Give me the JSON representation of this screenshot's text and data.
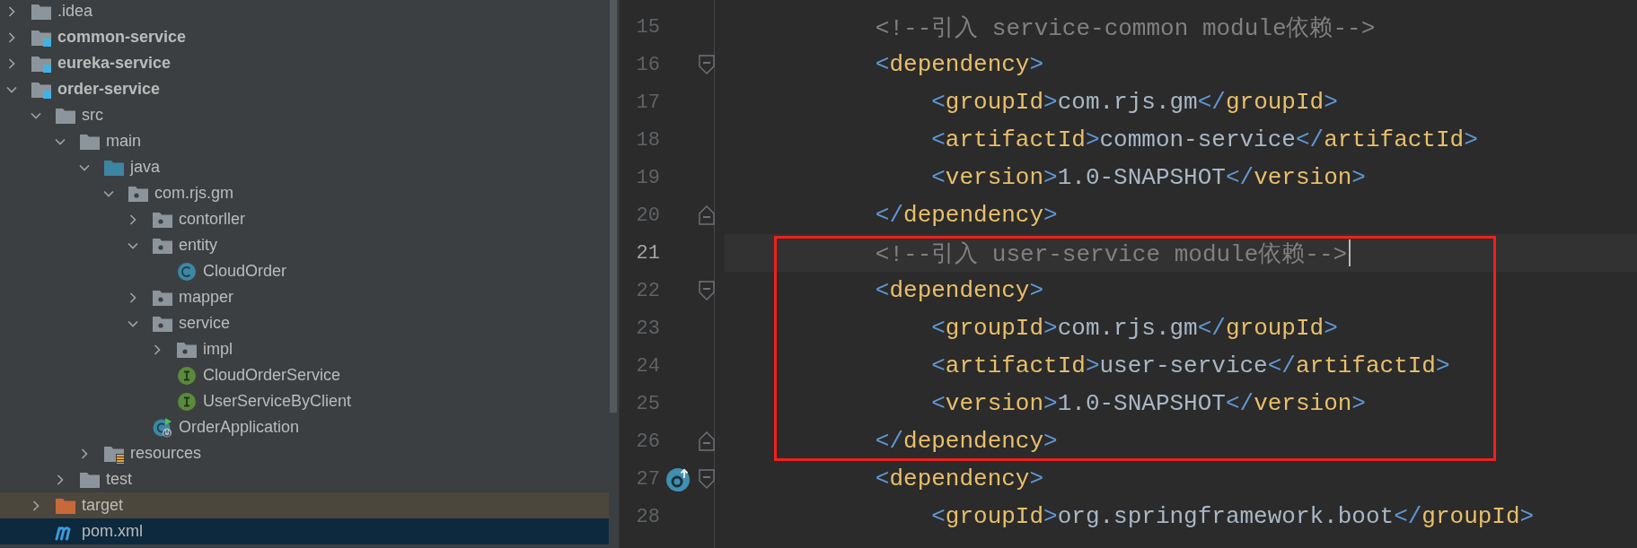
{
  "project_tree": {
    "items": [
      {
        "label": ".idea",
        "kind": "folder",
        "expanded": false,
        "selected": false,
        "highlighted": false
      },
      {
        "label": "common-service",
        "kind": "module",
        "expanded": false,
        "selected": false,
        "highlighted": false
      },
      {
        "label": "eureka-service",
        "kind": "module",
        "expanded": false,
        "selected": false,
        "highlighted": false
      },
      {
        "label": "order-service",
        "kind": "module",
        "expanded": true,
        "selected": false,
        "highlighted": false,
        "children": [
          {
            "label": "src",
            "kind": "folder",
            "expanded": true,
            "selected": false,
            "highlighted": false,
            "children": [
              {
                "label": "main",
                "kind": "folder",
                "expanded": true,
                "selected": false,
                "highlighted": false,
                "children": [
                  {
                    "label": "java",
                    "kind": "source-folder",
                    "expanded": true,
                    "selected": false,
                    "highlighted": false,
                    "children": [
                      {
                        "label": "com.rjs.gm",
                        "kind": "package",
                        "expanded": true,
                        "selected": false,
                        "highlighted": false,
                        "children": [
                          {
                            "label": "contorller",
                            "kind": "package",
                            "expanded": false,
                            "selected": false,
                            "highlighted": false
                          },
                          {
                            "label": "entity",
                            "kind": "package",
                            "expanded": true,
                            "selected": false,
                            "highlighted": false,
                            "children": [
                              {
                                "label": "CloudOrder",
                                "kind": "class",
                                "selected": false,
                                "highlighted": false
                              }
                            ]
                          },
                          {
                            "label": "mapper",
                            "kind": "package",
                            "expanded": false,
                            "selected": false,
                            "highlighted": false
                          },
                          {
                            "label": "service",
                            "kind": "package",
                            "expanded": true,
                            "selected": false,
                            "highlighted": false,
                            "children": [
                              {
                                "label": "impl",
                                "kind": "package",
                                "expanded": false,
                                "selected": false,
                                "highlighted": false
                              },
                              {
                                "label": "CloudOrderService",
                                "kind": "interface",
                                "selected": false,
                                "highlighted": false
                              },
                              {
                                "label": "UserServiceByClient",
                                "kind": "interface",
                                "selected": false,
                                "highlighted": false
                              }
                            ]
                          },
                          {
                            "label": "OrderApplication",
                            "kind": "spring-app",
                            "selected": false,
                            "highlighted": false
                          }
                        ]
                      }
                    ]
                  },
                  {
                    "label": "resources",
                    "kind": "resources-folder",
                    "expanded": false,
                    "selected": false,
                    "highlighted": false
                  }
                ]
              },
              {
                "label": "test",
                "kind": "folder",
                "expanded": false,
                "selected": false,
                "highlighted": false
              }
            ]
          },
          {
            "label": "target",
            "kind": "excluded-folder",
            "expanded": false,
            "selected": false,
            "highlighted": true
          },
          {
            "label": "pom.xml",
            "kind": "maven",
            "selected": true,
            "highlighted": false
          }
        ]
      }
    ]
  },
  "editor": {
    "lines": [
      {
        "number": "15",
        "kind": "plain",
        "override_marker": false,
        "current": false,
        "framed": false,
        "tokens": [
          {
            "kind": "comment",
            "text": "        <!--引入 service-common module依赖-->"
          }
        ]
      },
      {
        "number": "16",
        "kind": "fold-start",
        "override_marker": false,
        "current": false,
        "framed": false,
        "tokens": [
          {
            "kind": "bracket",
            "text": "        <"
          },
          {
            "kind": "tag",
            "text": "dependency"
          },
          {
            "kind": "bracket",
            "text": ">"
          }
        ]
      },
      {
        "number": "17",
        "kind": "plain",
        "override_marker": false,
        "current": false,
        "framed": false,
        "tokens": [
          {
            "kind": "bracket",
            "text": "            <"
          },
          {
            "kind": "tag",
            "text": "groupId"
          },
          {
            "kind": "bracket",
            "text": ">"
          },
          {
            "kind": "value",
            "text": "com.rjs.gm"
          },
          {
            "kind": "bracket",
            "text": "</"
          },
          {
            "kind": "tag",
            "text": "groupId"
          },
          {
            "kind": "bracket",
            "text": ">"
          }
        ]
      },
      {
        "number": "18",
        "kind": "plain",
        "override_marker": false,
        "current": false,
        "framed": false,
        "tokens": [
          {
            "kind": "bracket",
            "text": "            <"
          },
          {
            "kind": "tag",
            "text": "artifactId"
          },
          {
            "kind": "bracket",
            "text": ">"
          },
          {
            "kind": "value",
            "text": "common-service"
          },
          {
            "kind": "bracket",
            "text": "</"
          },
          {
            "kind": "tag",
            "text": "artifactId"
          },
          {
            "kind": "bracket",
            "text": ">"
          }
        ]
      },
      {
        "number": "19",
        "kind": "plain",
        "override_marker": false,
        "current": false,
        "framed": false,
        "tokens": [
          {
            "kind": "bracket",
            "text": "            <"
          },
          {
            "kind": "tag",
            "text": "version"
          },
          {
            "kind": "bracket",
            "text": ">"
          },
          {
            "kind": "value",
            "text": "1.0-SNAPSHOT"
          },
          {
            "kind": "bracket",
            "text": "</"
          },
          {
            "kind": "tag",
            "text": "version"
          },
          {
            "kind": "bracket",
            "text": ">"
          }
        ]
      },
      {
        "number": "20",
        "kind": "fold-end",
        "override_marker": false,
        "current": false,
        "framed": false,
        "tokens": [
          {
            "kind": "bracket",
            "text": "        </"
          },
          {
            "kind": "tag",
            "text": "dependency"
          },
          {
            "kind": "bracket",
            "text": ">"
          }
        ]
      },
      {
        "number": "21",
        "kind": "plain",
        "override_marker": false,
        "current": true,
        "framed": true,
        "tokens": [
          {
            "kind": "comment",
            "text": "        <!--引入 user-service module依赖-->"
          }
        ]
      },
      {
        "number": "22",
        "kind": "fold-start",
        "override_marker": false,
        "current": false,
        "framed": true,
        "tokens": [
          {
            "kind": "bracket",
            "text": "        <"
          },
          {
            "kind": "tag",
            "text": "dependency"
          },
          {
            "kind": "bracket",
            "text": ">"
          }
        ]
      },
      {
        "number": "23",
        "kind": "plain",
        "override_marker": false,
        "current": false,
        "framed": true,
        "tokens": [
          {
            "kind": "bracket",
            "text": "            <"
          },
          {
            "kind": "tag",
            "text": "groupId"
          },
          {
            "kind": "bracket",
            "text": ">"
          },
          {
            "kind": "value",
            "text": "com.rjs.gm"
          },
          {
            "kind": "bracket",
            "text": "</"
          },
          {
            "kind": "tag",
            "text": "groupId"
          },
          {
            "kind": "bracket",
            "text": ">"
          }
        ]
      },
      {
        "number": "24",
        "kind": "plain",
        "override_marker": false,
        "current": false,
        "framed": true,
        "tokens": [
          {
            "kind": "bracket",
            "text": "            <"
          },
          {
            "kind": "tag",
            "text": "artifactId"
          },
          {
            "kind": "bracket",
            "text": ">"
          },
          {
            "kind": "value",
            "text": "user-service"
          },
          {
            "kind": "bracket",
            "text": "</"
          },
          {
            "kind": "tag",
            "text": "artifactId"
          },
          {
            "kind": "bracket",
            "text": ">"
          }
        ]
      },
      {
        "number": "25",
        "kind": "plain",
        "override_marker": false,
        "current": false,
        "framed": true,
        "tokens": [
          {
            "kind": "bracket",
            "text": "            <"
          },
          {
            "kind": "tag",
            "text": "version"
          },
          {
            "kind": "bracket",
            "text": ">"
          },
          {
            "kind": "value",
            "text": "1.0-SNAPSHOT"
          },
          {
            "kind": "bracket",
            "text": "</"
          },
          {
            "kind": "tag",
            "text": "version"
          },
          {
            "kind": "bracket",
            "text": ">"
          }
        ]
      },
      {
        "number": "26",
        "kind": "fold-end",
        "override_marker": false,
        "current": false,
        "framed": true,
        "tokens": [
          {
            "kind": "bracket",
            "text": "        </"
          },
          {
            "kind": "tag",
            "text": "dependency"
          },
          {
            "kind": "bracket",
            "text": ">"
          }
        ]
      },
      {
        "number": "27",
        "kind": "fold-start",
        "override_marker": true,
        "current": false,
        "framed": false,
        "tokens": [
          {
            "kind": "bracket",
            "text": "        <"
          },
          {
            "kind": "tag",
            "text": "dependency"
          },
          {
            "kind": "bracket",
            "text": ">"
          }
        ]
      },
      {
        "number": "28",
        "kind": "plain",
        "override_marker": false,
        "current": false,
        "framed": false,
        "tokens": [
          {
            "kind": "bracket",
            "text": "            <"
          },
          {
            "kind": "tag",
            "text": "groupId"
          },
          {
            "kind": "bracket",
            "text": ">"
          },
          {
            "kind": "value",
            "text": "org.springframework.boot"
          },
          {
            "kind": "bracket",
            "text": "</"
          },
          {
            "kind": "tag",
            "text": "groupId"
          },
          {
            "kind": "bracket",
            "text": ">"
          }
        ]
      }
    ]
  }
}
